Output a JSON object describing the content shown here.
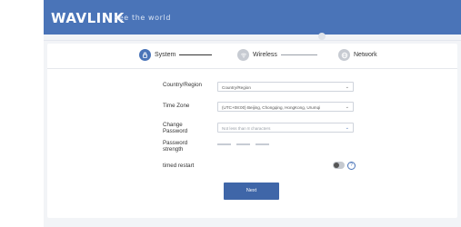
{
  "header": {
    "brand": "WAVLINK",
    "tagline": "see the world"
  },
  "steps": [
    {
      "label": "System",
      "icon": "lock-icon",
      "state": "active"
    },
    {
      "label": "Wireless",
      "icon": "wifi-icon",
      "state": "inactive"
    },
    {
      "label": "Network",
      "icon": "globe-icon",
      "state": "inactive"
    }
  ],
  "form": {
    "country": {
      "label": "Country/Region",
      "value": "Country/Region"
    },
    "timezone": {
      "label": "Time Zone",
      "value": "(UTC+08:00) Beijing, Chongqing, HongKong, Urumqi"
    },
    "password": {
      "label_line1": "Change",
      "label_line2": "Password",
      "placeholder": "Not less than 8 characters"
    },
    "strength": {
      "label_line1": "Password",
      "label_line2": "strength"
    },
    "restart": {
      "label": "timed restart",
      "help": "?"
    },
    "next_label": "Next"
  },
  "colors": {
    "accent": "#4a74b8",
    "button": "#3f66a8"
  }
}
